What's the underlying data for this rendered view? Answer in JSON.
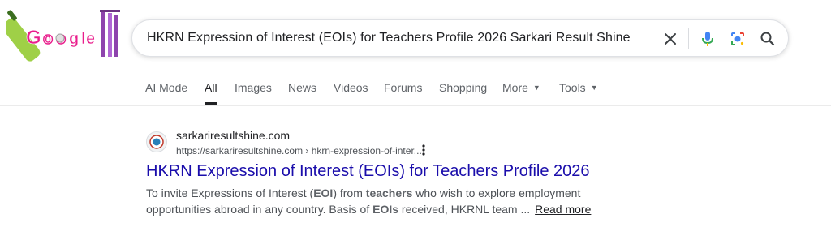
{
  "logo": {
    "text": "Google",
    "letters": [
      "G",
      "o",
      "o",
      "g",
      "l",
      "e"
    ]
  },
  "search": {
    "query": "HKRN Expression of Interest (EOIs) for Teachers Profile 2026 Sarkari Result Shine",
    "icons": [
      "close-icon",
      "microphone-icon",
      "lens-icon",
      "search-icon"
    ]
  },
  "tabs": [
    {
      "label": "AI Mode"
    },
    {
      "label": "All",
      "active": true
    },
    {
      "label": "Images"
    },
    {
      "label": "News"
    },
    {
      "label": "Videos"
    },
    {
      "label": "Forums"
    },
    {
      "label": "Shopping"
    },
    {
      "label": "More"
    },
    {
      "label": "Tools"
    }
  ],
  "result": {
    "site_name": "sarkariresultshine.com",
    "url": "https://sarkariresultshine.com › hkrn-expression-of-inter...",
    "title": "HKRN Expression of Interest (EOIs) for Teachers Profile 2026",
    "snippet": {
      "p1": "To invite Expressions of Interest (",
      "b1": "EOI",
      "p2": ") from ",
      "b2": "teachers",
      "p3": " who wish to explore employment opportunities abroad in any country. Basis of ",
      "b3": "EOIs",
      "p4": " received, HKRNL team ...",
      "read_more": "Read more"
    }
  },
  "colors": {
    "link": "#1a0dab",
    "text": "#202124",
    "muted": "#4d5156"
  }
}
